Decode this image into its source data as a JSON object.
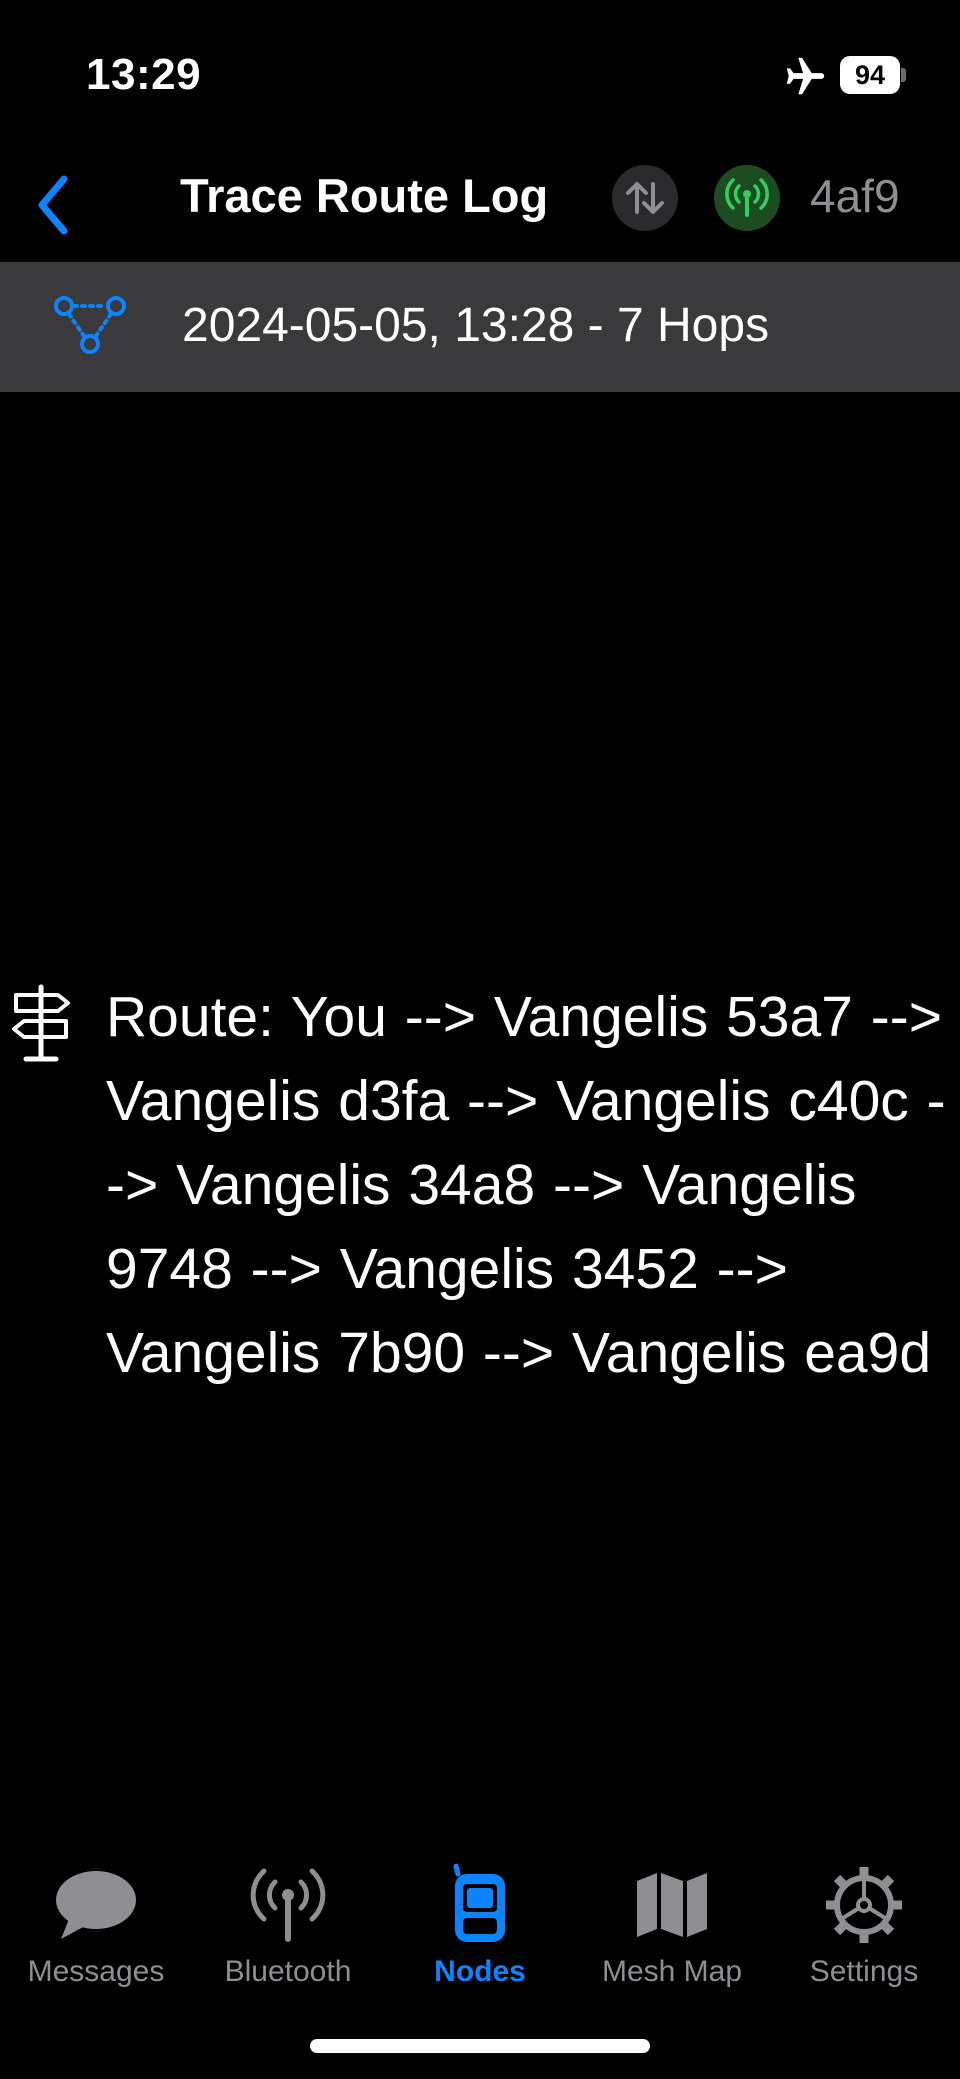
{
  "status_bar": {
    "time": "13:29",
    "battery_level": "94",
    "icons": [
      "airplane-icon",
      "battery-icon"
    ]
  },
  "nav": {
    "back_icon": "chevron-left-icon",
    "title": "Trace Route Log",
    "sync_icon": "arrow-up-down-icon",
    "radio_icon": "antenna-radiowaves-icon",
    "node_id": "4af9"
  },
  "log": {
    "entries": [
      {
        "icon": "route-nodes-icon",
        "label": "2024-05-05, 13:28 - 7 Hops"
      }
    ]
  },
  "route": {
    "icon": "signpost-icon",
    "text": "Route: You --> Vangelis 53a7 --> Vangelis d3fa  --> Vangelis c40c  --> Vangelis 34a8  --> Vangelis 9748  --> Vangelis 3452  --> Vangelis 7b90  --> Vangelis ea9d"
  },
  "tabs": [
    {
      "label": "Messages",
      "icon": "message-bubble-icon",
      "active": false
    },
    {
      "label": "Bluetooth",
      "icon": "antenna-icon",
      "active": false
    },
    {
      "label": "Nodes",
      "icon": "flipphone-icon",
      "active": true
    },
    {
      "label": "Mesh Map",
      "icon": "map-icon",
      "active": false
    },
    {
      "label": "Settings",
      "icon": "gear-icon",
      "active": false
    }
  ],
  "colors": {
    "accent": "#0a84ff",
    "connected_green": "#30d158",
    "row_background": "#3a3a3c",
    "inactive_gray": "#8e8e93"
  }
}
